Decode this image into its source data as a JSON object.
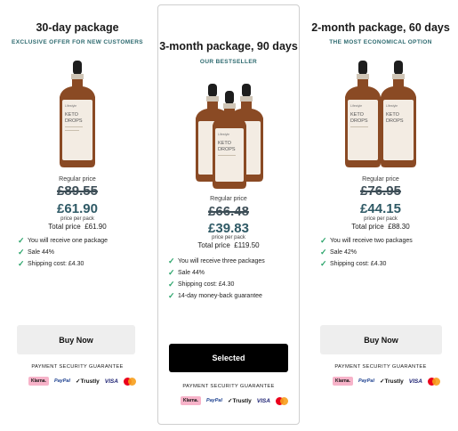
{
  "packages": [
    {
      "title": "30-day package",
      "subtitle": "EXCLUSIVE OFFER FOR NEW CUSTOMERS",
      "product": {
        "brand": "Lifestyle",
        "name_line1": "KETO",
        "name_line2": "DROPS",
        "bottle_count": 1
      },
      "regular_price_label": "Regular price",
      "old_price": "£89.55",
      "new_price": "£61.90",
      "per_pack_label": "price per pack",
      "total_label": "Total price",
      "total_value": "£61.90",
      "features": [
        "You will receive one package",
        "Sale 44%",
        "Shipping cost: £4.30"
      ],
      "button_label": "Buy Now",
      "security_label": "PAYMENT SECURITY GUARANTEE"
    },
    {
      "title": "3-month package, 90 days",
      "subtitle": "OUR BESTSELLER",
      "product": {
        "brand": "Lifestyle",
        "name_line1": "KETO",
        "name_line2": "DROPS",
        "bottle_count": 3
      },
      "regular_price_label": "Regular price",
      "old_price": "£66.48",
      "new_price": "£39.83",
      "per_pack_label": "price per pack",
      "total_label": "Total price",
      "total_value": "£119.50",
      "features": [
        "You will receive three packages",
        "Sale 44%",
        "Shipping cost: £4.30",
        "14-day money-back guarantee"
      ],
      "button_label": "Selected",
      "security_label": "PAYMENT SECURITY GUARANTEE"
    },
    {
      "title": "2-month package, 60 days",
      "subtitle": "THE MOST ECONOMICAL OPTION",
      "product": {
        "brand": "Lifestyle",
        "name_line1": "KETO",
        "name_line2": "DROPS",
        "bottle_count": 2
      },
      "regular_price_label": "Regular price",
      "old_price": "£76.95",
      "new_price": "£44.15",
      "per_pack_label": "price per pack",
      "total_label": "Total price",
      "total_value": "£88.30",
      "features": [
        "You will receive two packages",
        "Sale 42%",
        "Shipping cost: £4.30"
      ],
      "button_label": "Buy Now",
      "security_label": "PAYMENT SECURITY GUARANTEE"
    }
  ],
  "payment_logos": {
    "klarna": "Klarna.",
    "paypal": "PayPal",
    "trustly": "Trustly",
    "visa": "VISA",
    "mastercard_icon": "mastercard-icon"
  },
  "colors": {
    "subtitle": "#2d6a6f",
    "new_price": "#2f5a66",
    "check": "#2aa46a",
    "selected_button": "#000000",
    "buy_button": "#eeeeee",
    "bottle_amber": "#8a4a24",
    "bottle_label": "#f3ece3"
  }
}
